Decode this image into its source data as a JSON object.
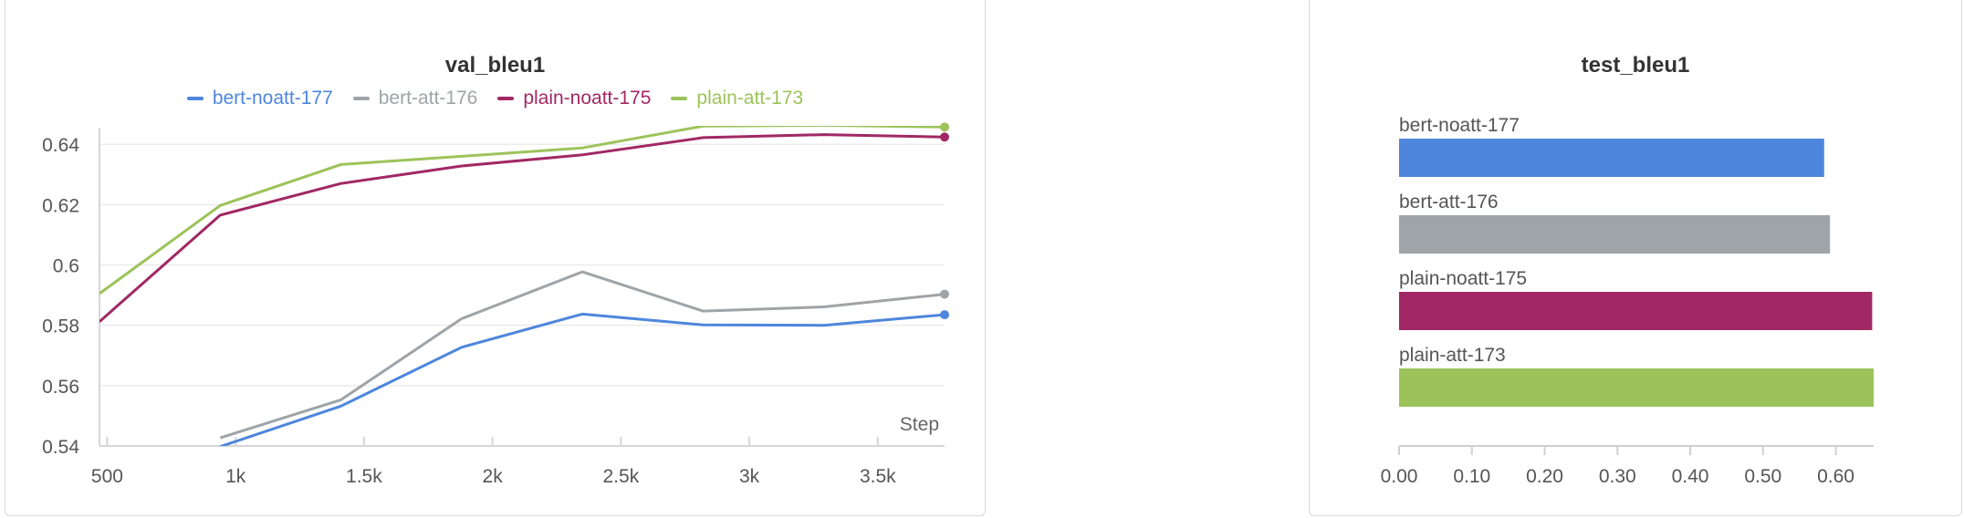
{
  "left_panel": {
    "title": "val_bleu1",
    "legend": [
      {
        "label": "bert-noatt-177",
        "color": "#4e86dc"
      },
      {
        "label": "bert-att-176",
        "color": "#9ea4a8"
      },
      {
        "label": "plain-noatt-175",
        "color": "#a12864"
      },
      {
        "label": "plain-att-173",
        "color": "#9cc359"
      }
    ]
  },
  "right_panel": {
    "title": "test_bleu1"
  },
  "chart_data": [
    {
      "type": "line",
      "title": "val_bleu1",
      "xlabel": "Step",
      "ylabel": "",
      "xlim": [
        470,
        3760
      ],
      "ylim": [
        0.54,
        0.6455
      ],
      "x_ticks": [
        500,
        1000,
        1500,
        2000,
        2500,
        3000,
        3500
      ],
      "x_tick_labels": [
        "500",
        "1k",
        "1.5k",
        "2k",
        "2.5k",
        "3k",
        "3.5k"
      ],
      "y_ticks": [
        0.54,
        0.56,
        0.58,
        0.6,
        0.62,
        0.64
      ],
      "y_tick_labels": [
        "0.54",
        "0.56",
        "0.58",
        "0.6",
        "0.62",
        "0.64"
      ],
      "grid": true,
      "legend_position": "top",
      "series": [
        {
          "name": "bert-noatt-177",
          "color": "#4e86dc",
          "x": [
            940,
            1410,
            1880,
            2350,
            2820,
            3290,
            3760
          ],
          "y": [
            0.5398,
            0.5532,
            0.5727,
            0.5837,
            0.5801,
            0.58,
            0.5835
          ]
        },
        {
          "name": "bert-att-176",
          "color": "#9ea4a8",
          "x": [
            940,
            1410,
            1880,
            2350,
            2820,
            3290,
            3760
          ],
          "y": [
            0.5427,
            0.5553,
            0.5822,
            0.5977,
            0.5847,
            0.5861,
            0.5903
          ]
        },
        {
          "name": "plain-noatt-175",
          "color": "#a12864",
          "x": [
            470,
            940,
            1410,
            1880,
            2350,
            2820,
            3290,
            3760
          ],
          "y": [
            0.5812,
            0.6165,
            0.627,
            0.6328,
            0.6365,
            0.6422,
            0.6432,
            0.6424
          ]
        },
        {
          "name": "plain-att-173",
          "color": "#9cc359",
          "x": [
            470,
            940,
            1410,
            1880,
            2350,
            2820,
            3290,
            3760
          ],
          "y": [
            0.5905,
            0.6197,
            0.6333,
            0.636,
            0.6388,
            0.646,
            0.6463,
            0.6457
          ]
        }
      ]
    },
    {
      "type": "bar",
      "orientation": "horizontal",
      "title": "test_bleu1",
      "categories": [
        "bert-noatt-177",
        "bert-att-176",
        "plain-noatt-175",
        "plain-att-173"
      ],
      "values": [
        0.584,
        0.592,
        0.65,
        0.652
      ],
      "colors": [
        "#4e86dc",
        "#9ea4a8",
        "#a12864",
        "#9cc359"
      ],
      "xlim": [
        0,
        0.652
      ],
      "x_ticks": [
        0,
        0.1,
        0.2,
        0.3,
        0.4,
        0.5,
        0.6
      ],
      "x_tick_labels": [
        "0.00",
        "0.10",
        "0.20",
        "0.30",
        "0.40",
        "0.50",
        "0.60"
      ],
      "grid": false
    }
  ]
}
